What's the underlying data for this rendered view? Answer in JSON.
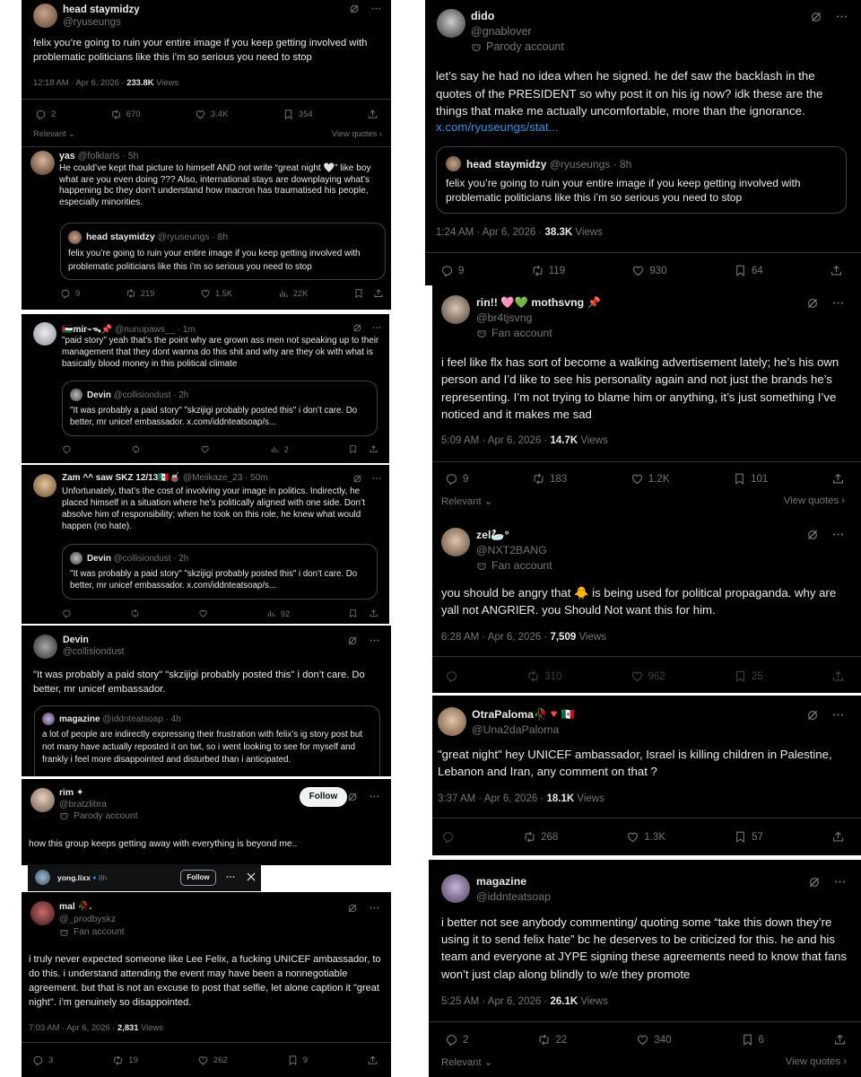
{
  "p1": {
    "name": "head staymidzy",
    "handle": "@ryuseungs",
    "text": "felix you’re going to ruin your entire image if you keep getting involved with problematic politicians like this i’m so serious you need to stop",
    "time": "12:18 AM · Apr 6, 2026 · ",
    "views_num": "233.8K",
    "views_word": " Views",
    "replies": "2",
    "reposts": "670",
    "likes": "3.4K",
    "bookmarks": "354",
    "relevant": "Relevant",
    "view_quotes": "View quotes"
  },
  "p2": {
    "name": "yas",
    "handle": "@folklaris · 5h",
    "text": "He could’ve kept that picture to himself AND not write “great night 🤍” like boy what are you even doing ??? Also, international stays are downplaying what’s happening bc they don’t understand how macron has traumatised his people, especially minorities.",
    "q_name": "head staymidzy",
    "q_handle": "@ryuseungs · 8h",
    "q_text": "felix you’re going to ruin your entire image if you keep getting involved with problematic politicians like this i’m so serious you need to stop",
    "replies": "9",
    "reposts": "219",
    "likes": "1.5K",
    "views": "22K"
  },
  "p3": {
    "name": "🇵🇸mir⌁ᯓ📌",
    "handle": "@nunupaws__ · 1m",
    "text": "\"paid story\" yeah that’s the point why are grown ass men not speaking up to their management that they dont wanna do this shit and why are they ok with what is basically blood money in this political climate",
    "q_name": "Devin",
    "q_handle": "@collisiondust · 2h",
    "q_text": "\"It was probably a paid story\" \"skzijigi probably posted this\" i don’t care. Do better, mr unicef embassador. x.com/iddnteatsoap/s...",
    "views": "2"
  },
  "p4": {
    "name": "Zam ^^ saw SKZ 12/13🇲🇽🧉",
    "handle": "@Meiikaze_23 · 50m",
    "text": "Unfortunately, that’s the cost of involving your image in politics. Indirectly, he placed himself in a situation where he’s politically aligned with one side. Don’t absolve him of responsibility; when he took on this role, he knew what would happen (no hate).",
    "q_name": "Devin",
    "q_handle": "@collisiondust · 2h",
    "q_text": "\"It was probably a paid story\" \"skzijigi probably posted this\" i don’t care. Do better, mr unicef embassador. x.com/iddnteatsoap/s...",
    "views": "92"
  },
  "p5": {
    "name": "Devin",
    "handle": "@collisiondust",
    "text": "\"It was probably a paid story\" \"skzijigi probably posted this\" i don’t care. Do better, mr unicef embassador.",
    "q_name": "magazine",
    "q_handle": "@iddnteatsoap · 4h",
    "q_text": "a lot of people are indirectly expressing their frustration with felix’s ig story post but not many have actually reposted it on twt, so i went looking to see for myself and frankly i feel more disappointed and disturbed than i anticipated."
  },
  "p6": {
    "name": "rim ✦",
    "handle": "@bratzlibra",
    "badge": "Parody account",
    "follow": "Follow",
    "text": "how this group keeps getting away with everything is beyond me..",
    "story_user": "yong.lixx",
    "story_time": "8h",
    "story_follow": "Follow"
  },
  "p7": {
    "name": "mal 🥀.",
    "handle": "@_prodbyskz",
    "badge": "Fan account",
    "text": "i truly never expected someone like Lee Felix, a fucking UNICEF ambassador, to do this. i understand attending the event may have been a nonnegotiable agreement. but that is not an excuse to post that selfie, let alone caption it \"great night\". i’m genuinely so disappointed.",
    "time": "7:03 AM · Apr 6, 2026 · ",
    "views_num": "2,831",
    "views_word": " Views",
    "replies": "3",
    "reposts": "19",
    "likes": "262",
    "bookmarks": "9"
  },
  "r1": {
    "name": "dido",
    "handle": "@gnablover",
    "badge": "Parody account",
    "text": "let’s say he had no idea when he signed. he def saw the backlash in the quotes of the PRESIDENT so why post it on his ig now? idk these are the things that make me actually uncomfortable, more than the ignorance.",
    "link": "x.com/ryuseungs/stat...",
    "q_name": "head staymidzy",
    "q_handle": "@ryuseungs · 8h",
    "q_text": "felix you’re going to ruin your entire image if you keep getting involved with problematic politicians like this i’m so serious you need to stop",
    "time": "1:24 AM · Apr 6, 2026 · ",
    "views_num": "38.3K",
    "views_word": " Views",
    "replies": "9",
    "reposts": "119",
    "likes": "930",
    "bookmarks": "64"
  },
  "r2": {
    "name": "rin!! 🩷💚 mothsvng 📌",
    "handle": "@br4tjsvng",
    "badge": "Fan account",
    "text": "i feel like flx has sort of become a walking advertisement lately; he’s his own person and I’d like to see his personality again and not just the brands he’s representing. I’m not trying to blame him or anything, it’s just something I’ve noticed and it makes me sad",
    "time": "5:09 AM · Apr 6, 2026 · ",
    "views_num": "14.7K",
    "views_word": " Views",
    "replies": "9",
    "reposts": "183",
    "likes": "1.2K",
    "bookmarks": "101",
    "relevant": "Relevant",
    "view_quotes": "View quotes"
  },
  "r3": {
    "name": "zel🦢°",
    "handle": "@NXT2BANG",
    "badge": "Fan account",
    "text": "you should be angry that 🐥 is being used for political propaganda. why are yall not ANGRIER. you Should Not want this for him.",
    "time": "6:28 AM · Apr 6, 2026 · ",
    "views_num": "7,509",
    "views_word": " Views",
    "reposts": "310",
    "likes": "962",
    "bookmarks": "25"
  },
  "r4": {
    "name": "OtraPaloma🥀🔻🇲🇽",
    "handle": "@Una2daPaloma",
    "text": "\"great night\" hey UNICEF ambassador, Israel is killing children in Palestine, Lebanon and Iran, any comment on that ?",
    "time": "3:37 AM · Apr 6, 2026 · ",
    "views_num": "18.1K",
    "views_word": " Views",
    "reposts": "268",
    "likes": "1.3K",
    "bookmarks": "57"
  },
  "r5": {
    "name": "magazine",
    "handle": "@iddnteatsoap",
    "text": "i better not see anybody commenting/ quoting some “take this down they’re using it to send felix hate” bc he deserves to be criticized for this. he and his team and everyone at JYPE signing these agreements need to know that fans won’t just clap along blindly to w/e they promote",
    "time": "5:25 AM · Apr 6, 2026 · ",
    "views_num": "26.1K",
    "views_word": " Views",
    "replies": "2",
    "reposts": "22",
    "likes": "340",
    "bookmarks": "6",
    "relevant": "Relevant",
    "view_quotes": "View quotes"
  },
  "icons": [
    "grok-icon",
    "more-icon",
    "reply-icon",
    "repost-icon",
    "like-icon",
    "bookmark-icon",
    "share-icon",
    "views-icon",
    "mask-icon",
    "chevron-down-icon",
    "chevron-right-icon",
    "close-icon"
  ]
}
